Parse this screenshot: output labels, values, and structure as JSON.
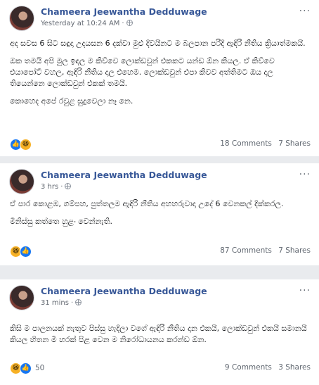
{
  "posts": [
    {
      "author": "Chameera Jeewantha Dedduwage",
      "time": "Yesterday at 10:24 AM",
      "paragraphs": [
        "අද සවස 6 සිට සඳුදා උදයසන 6 දක්වා මුළු දිවයිනට ම බලපාන පරිදි ඇඳිරි නීතිය ක්‍රියාත්මකයි.",
        "ඔක තමයි අපි මුල ඉඳල ම කිව්වෙ ලොක්ඩවුන් එකකට යන්ඩ ඕන කියල. ඒ කිව්වෙ එයාපෝට් වහල, ඇඳිරි නීතිය දාල එහෙම. ලොක්ඩවුන් එපා කිවව අත්තිමට ඔය දාල තියෙන්නෙ ලොක්ඩවුන් එකක් තමයි.",
        "කොහෙද අපේ රවුළ සුදුවෙලා නෑ නෙ."
      ],
      "reaction_types": [
        "like",
        "haha"
      ],
      "reaction_count": "",
      "comments": "18 Comments",
      "shares": "7 Shares"
    },
    {
      "author": "Chameera Jeewantha Dedduwage",
      "time": "3 hrs",
      "paragraphs": [
        "ඒ පාර කොළඹ, ගම්පහ, පුත්තලම ඇඳිරි නීතිය අහහරුවාදා උදේ 6 වෙනකල් දික්කරල.",
        "මිනිස්සු කත්තෙ හුළං වෙන්නැති."
      ],
      "reaction_types": [
        "haha",
        "like"
      ],
      "reaction_count": "",
      "comments": "87 Comments",
      "shares": "7 Shares"
    },
    {
      "author": "Chameera Jeewantha Dedduwage",
      "time": "31 mins",
      "paragraphs": [
        "කිසි ම පාලනයක් නැතුව පිස්සු හැදිලා වගේ ඇඳිරි නීතිය දාන එකයි, ලොක්ඩවුන් එකයි සමානයි කියල හිතන මී හරක් පිළ වෙන ම නිරෝධායනය කරන්ඩ ඕන."
      ],
      "reaction_types": [
        "haha",
        "like"
      ],
      "reaction_count": "50",
      "comments": "9 Comments",
      "shares": "3 Shares"
    }
  ]
}
